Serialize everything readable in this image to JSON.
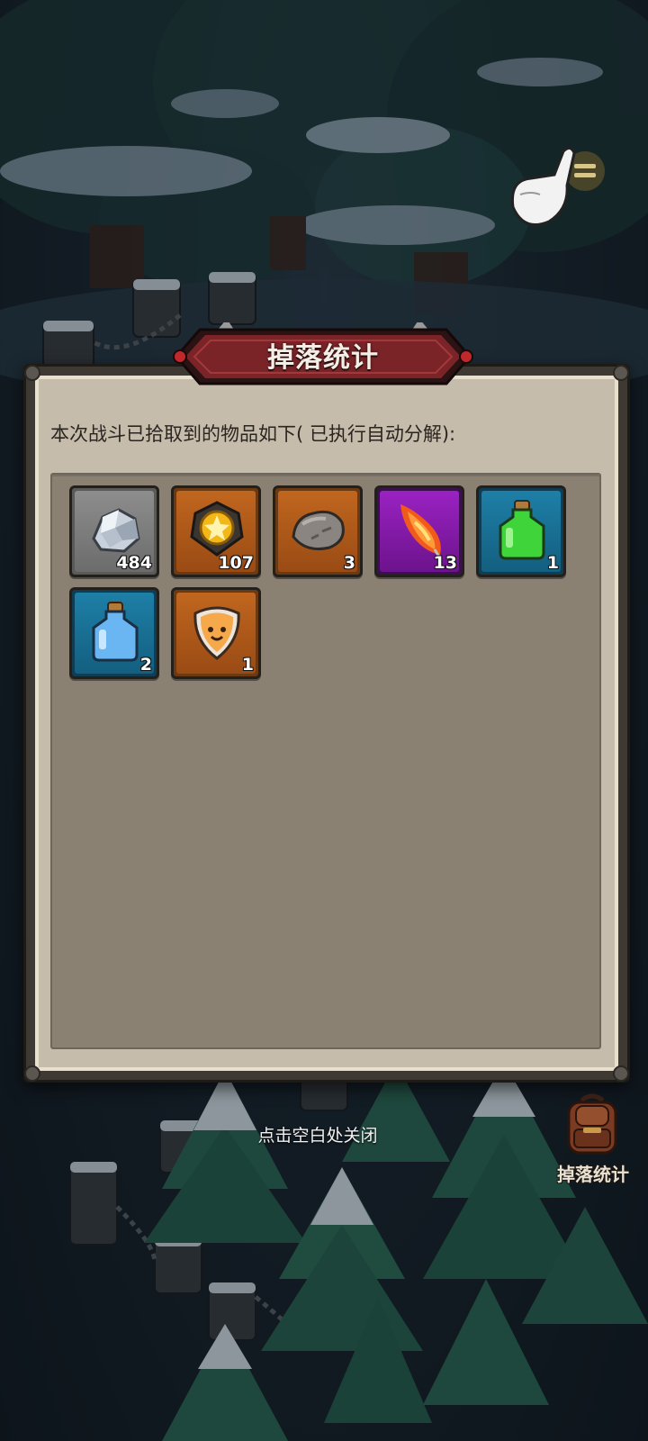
{
  "dialog": {
    "title": "掉落统计",
    "description": "本次战斗已拾取到的物品如下( 已执行自动分解):"
  },
  "items": [
    {
      "icon": "silver-ore-icon",
      "rarity": "grey",
      "count": "484"
    },
    {
      "icon": "gold-star-medal-icon",
      "rarity": "orange",
      "count": "107"
    },
    {
      "icon": "stone-icon",
      "rarity": "orange",
      "count": "3"
    },
    {
      "icon": "flame-feather-icon",
      "rarity": "purple",
      "count": "13"
    },
    {
      "icon": "green-potion-icon",
      "rarity": "blue",
      "count": "1"
    },
    {
      "icon": "blue-potion-icon",
      "rarity": "blue",
      "count": "2"
    },
    {
      "icon": "smiling-shield-icon",
      "rarity": "orange",
      "count": "1"
    }
  ],
  "close_hint": "点击空白处关闭",
  "drop_stats_button": {
    "label": "掉落统计",
    "icon": "backpack-icon"
  },
  "colors": {
    "title_banner": "#7a2428",
    "panel_bg": "#c6bcab",
    "items_bg": "#8a8173"
  }
}
